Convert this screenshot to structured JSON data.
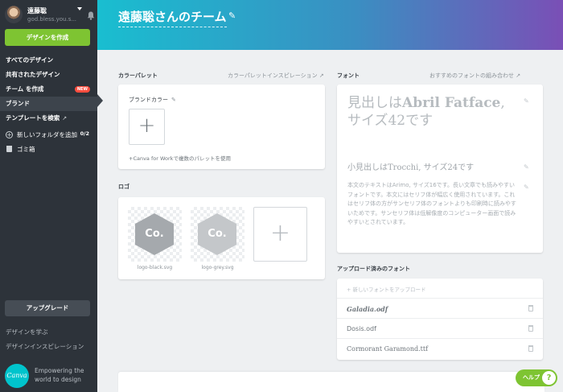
{
  "profile": {
    "name": "遠藤聡",
    "email": "god.bless.you.s..."
  },
  "sidebar": {
    "create_button": "デザインを作成",
    "items": [
      {
        "label": "すべてのデザイン"
      },
      {
        "label": "共有されたデザイン"
      },
      {
        "label": "チーム を作成",
        "badge": "NEW"
      },
      {
        "label": "ブランド",
        "active": true
      },
      {
        "label": "テンプレートを検索",
        "external": "↗"
      }
    ],
    "add_folder": {
      "label": "新しいフォルダを追加",
      "count": "0/2"
    },
    "trash": "ゴミ箱",
    "upgrade_button": "アップグレード",
    "learn_design": "デザインを学ぶ",
    "design_inspiration": "デザインインスピレーション",
    "logo_text": "Canva",
    "tagline": "Empowering the world to design"
  },
  "header": {
    "title": "遠藤聡さんのチーム"
  },
  "color_palette": {
    "label": "カラーパレット",
    "link": "カラーパレットインスピレーション ↗",
    "brand_colors_label": "ブランドカラー",
    "add_symbol": "+",
    "note": "+Canva for Workで複数のパレットを使用"
  },
  "logos": {
    "label": "ロゴ",
    "items": [
      {
        "text": "Co.",
        "caption": "logo-black.svg",
        "color": "#a5a9ad"
      },
      {
        "text": "Co.",
        "caption": "logo-grey.svg",
        "color": "#c4c7ca"
      }
    ],
    "add_symbol": "+"
  },
  "fonts": {
    "label": "フォント",
    "link": "おすすめのフォントの組み合わせ ↗",
    "heading_prefix": "見出しは",
    "heading_font": "Abril Fatface",
    "heading_suffix": ", サイズ42です",
    "subheading": "小見出しはTrocchi, サイズ24です",
    "body": "本文のテキストはArimo, サイズ16です。長い文章でも読みやすいフォントです。本文にはセリフ体が幅広く使用されています。これはセリフ体の方がサンセリフ体のフォントよりも印刷時に読みやすいためです。サンセリフ体は低解像度のコンピューター画面で読みやすいとされています。"
  },
  "uploaded_fonts": {
    "label": "アップロード済みのフォント",
    "upload_link": "+ 新しいフォントをアップロード",
    "items": [
      "Galadia.odf",
      "Dosis.odf",
      "Cormorant Garamond.ttf"
    ]
  },
  "help": {
    "label": "ヘルプ",
    "icon": "?"
  }
}
